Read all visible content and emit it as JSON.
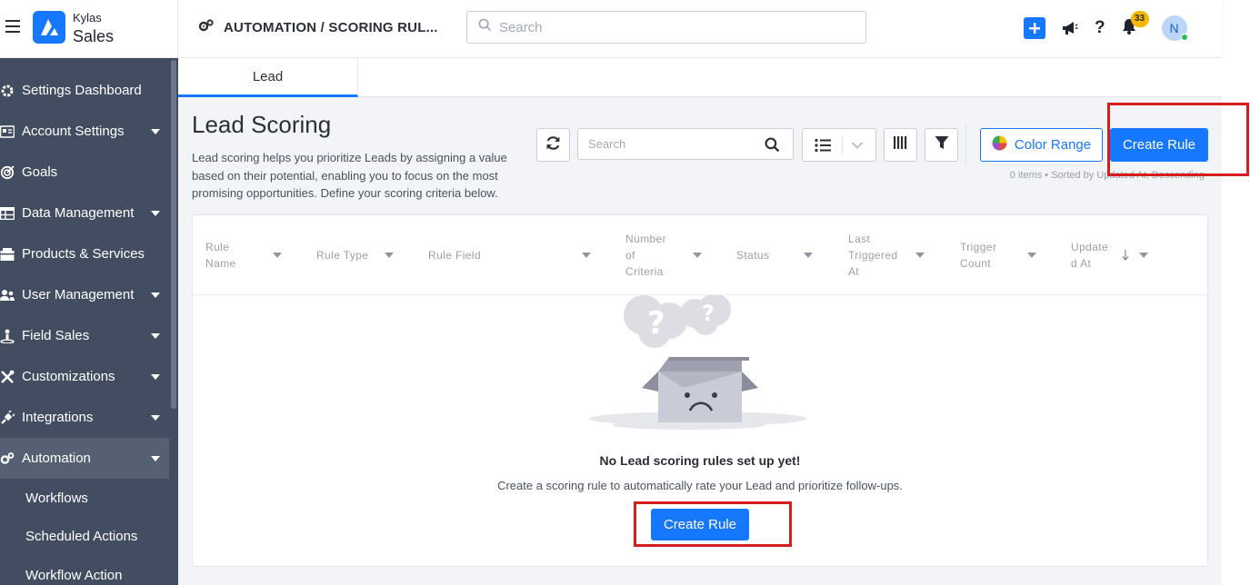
{
  "header": {
    "brand_top": "Kylas",
    "brand_main": "Sales",
    "breadcrumb": "AUTOMATION / SCORING RUL...",
    "search_placeholder": "Search",
    "help_label": "?",
    "notification_count": "33",
    "avatar_initial": "N",
    "accent_color": "#1677ff"
  },
  "sidebar": {
    "items": [
      {
        "label": "Settings Dashboard",
        "icon": "gear-icon"
      },
      {
        "label": "Account Settings",
        "icon": "id-card-icon"
      },
      {
        "label": "Goals",
        "icon": "target-icon"
      },
      {
        "label": "Data Management",
        "icon": "table-icon"
      },
      {
        "label": "Products & Services",
        "icon": "box-icon"
      },
      {
        "label": "User Management",
        "icon": "users-icon"
      },
      {
        "label": "Field Sales",
        "icon": "person-pin-icon"
      },
      {
        "label": "Customizations",
        "icon": "tools-icon"
      },
      {
        "label": "Integrations",
        "icon": "plug-icon"
      },
      {
        "label": "Automation",
        "icon": "gears-icon"
      }
    ],
    "sub_items": [
      {
        "label": "Workflows"
      },
      {
        "label": "Scheduled Actions"
      },
      {
        "label": "Workflow Action"
      }
    ]
  },
  "main": {
    "tab_label": "Lead",
    "title": "Lead Scoring",
    "description": "Lead scoring helps you prioritize Leads by assigning a value based on their potential, enabling you to focus on the most promising opportunities. Define your scoring criteria below.",
    "list_search_placeholder": "Search",
    "color_range_label": "Color Range",
    "create_rule_label": "Create Rule",
    "status_line": "0 items • Sorted by Updated At, Descending",
    "columns": [
      {
        "label": "Rule Name"
      },
      {
        "label": "Rule Type"
      },
      {
        "label": "Rule Field"
      },
      {
        "label": "Number of Criteria"
      },
      {
        "label": "Status"
      },
      {
        "label": "Last Triggered At"
      },
      {
        "label": "Trigger Count"
      },
      {
        "label": "Update d At"
      }
    ],
    "empty_title": "No Lead scoring rules set up yet!",
    "empty_subtitle": "Create a scoring rule to automatically rate your Lead and prioritize follow-ups.",
    "empty_create_label": "Create Rule"
  }
}
